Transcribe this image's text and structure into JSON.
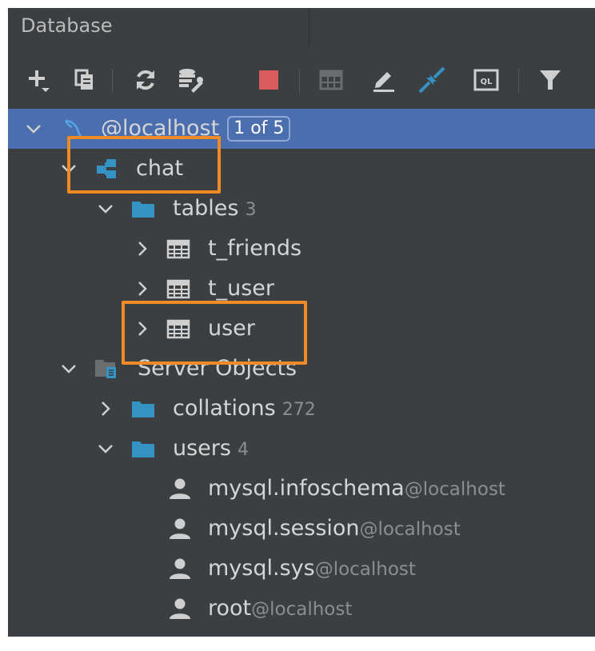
{
  "header": {
    "title": "Database"
  },
  "toolbar": {
    "buttons": [
      {
        "icon": "add-icon"
      },
      {
        "icon": "copy-icon"
      },
      {
        "icon": "refresh-icon"
      },
      {
        "icon": "db-settings-icon"
      },
      {
        "icon": "stop-icon"
      },
      {
        "icon": "table-icon"
      },
      {
        "icon": "edit-icon"
      },
      {
        "icon": "jump-to-icon"
      },
      {
        "icon": "console-icon"
      },
      {
        "icon": "filter-icon"
      }
    ],
    "console_icon_text": "QL"
  },
  "tree": {
    "host": {
      "label": "@localhost",
      "badge": "1 of 5"
    },
    "schema": {
      "label": "chat"
    },
    "tables_folder": {
      "label": "tables",
      "count": "3"
    },
    "tables": [
      {
        "label": "t_friends"
      },
      {
        "label": "t_user"
      },
      {
        "label": "user"
      }
    ],
    "server_objects": {
      "label": "Server Objects"
    },
    "collations": {
      "label": "collations",
      "count": "272"
    },
    "users_folder": {
      "label": "users",
      "count": "4"
    },
    "users": [
      {
        "name": "mysql.infoschema",
        "host": "@localhost"
      },
      {
        "name": "mysql.session",
        "host": "@localhost"
      },
      {
        "name": "mysql.sys",
        "host": "@localhost"
      },
      {
        "name": "root",
        "host": "@localhost"
      }
    ]
  },
  "colors": {
    "panel": "#3c3f41",
    "selection": "#4b6eaf",
    "highlight": "#f08a24",
    "folder": "#3592c4",
    "stop": "#db5c5c"
  }
}
